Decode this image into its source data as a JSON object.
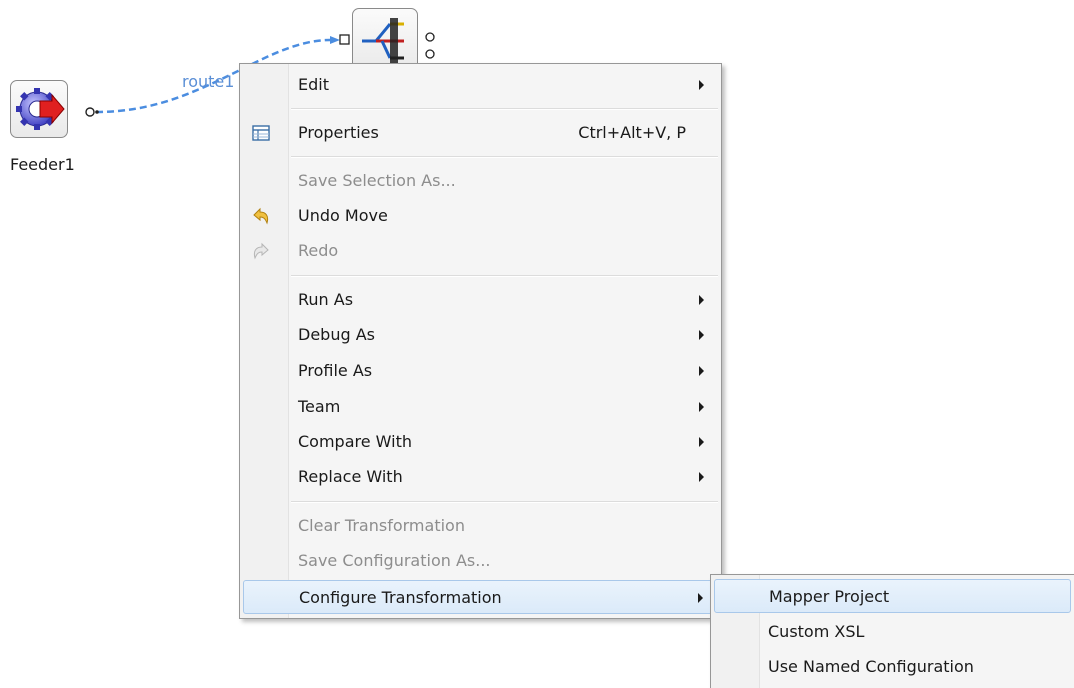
{
  "canvas": {
    "node_feeder": {
      "label": "Feeder1",
      "icon": "gear-arrow-icon"
    },
    "node_transform": {
      "icon": "router-icon"
    },
    "route": {
      "label": "route1",
      "color": "#5b8fd6"
    }
  },
  "context_menu": {
    "items": [
      {
        "label": "Edit",
        "has_submenu": true,
        "disabled": false
      },
      {
        "label": "Properties",
        "shortcut": "Ctrl+Alt+V, P",
        "icon": "properties-icon",
        "disabled": false
      },
      {
        "label": "Save Selection As...",
        "disabled": true
      },
      {
        "label": "Undo Move",
        "icon": "undo-icon",
        "disabled": false
      },
      {
        "label": "Redo",
        "icon": "redo-icon",
        "disabled": true
      },
      {
        "label": "Run As",
        "has_submenu": true,
        "disabled": false
      },
      {
        "label": "Debug As",
        "has_submenu": true,
        "disabled": false
      },
      {
        "label": "Profile As",
        "has_submenu": true,
        "disabled": false
      },
      {
        "label": "Team",
        "has_submenu": true,
        "disabled": false
      },
      {
        "label": "Compare With",
        "has_submenu": true,
        "disabled": false
      },
      {
        "label": "Replace With",
        "has_submenu": true,
        "disabled": false
      },
      {
        "label": "Clear Transformation",
        "disabled": true
      },
      {
        "label": "Save Configuration As...",
        "disabled": true
      },
      {
        "label": "Configure Transformation",
        "has_submenu": true,
        "highlighted": true,
        "disabled": false
      }
    ]
  },
  "submenu": {
    "items": [
      {
        "label": "Mapper Project",
        "highlighted": true
      },
      {
        "label": "Custom XSL"
      },
      {
        "label": "Use Named Configuration"
      }
    ]
  },
  "colors": {
    "highlight_bg": "#dbeaf9",
    "highlight_border": "#a9c8ea",
    "disabled_text": "#8d8d8d"
  }
}
